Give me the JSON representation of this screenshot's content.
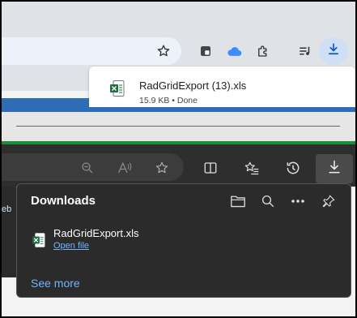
{
  "chrome": {
    "popup": {
      "file_name": "RadGridExport (13).xls",
      "file_meta": "15.9 KB • Done"
    }
  },
  "edge": {
    "side_text": "eb",
    "downloads_panel": {
      "title": "Downloads",
      "file_name": "RadGridExport.xls",
      "open_file_label": "Open file",
      "see_more_label": "See more"
    }
  },
  "icons": {
    "chrome_toolbar": [
      "star-icon",
      "extension-tab-icon",
      "cloud-icon",
      "puzzle-icon",
      "media-control-icon",
      "download-icon"
    ],
    "edge_toolbar": [
      "zoom-out-icon",
      "read-aloud-icon",
      "favorite-star-icon",
      "split-screen-icon",
      "favorites-list-icon",
      "history-icon",
      "download-icon"
    ],
    "panel": [
      "folder-icon",
      "search-icon",
      "more-icon",
      "pin-icon"
    ]
  },
  "colors": {
    "chrome_accent": "#0b57d0",
    "edge_link": "#6fb4ff",
    "excel_green": "#1d6f42"
  }
}
